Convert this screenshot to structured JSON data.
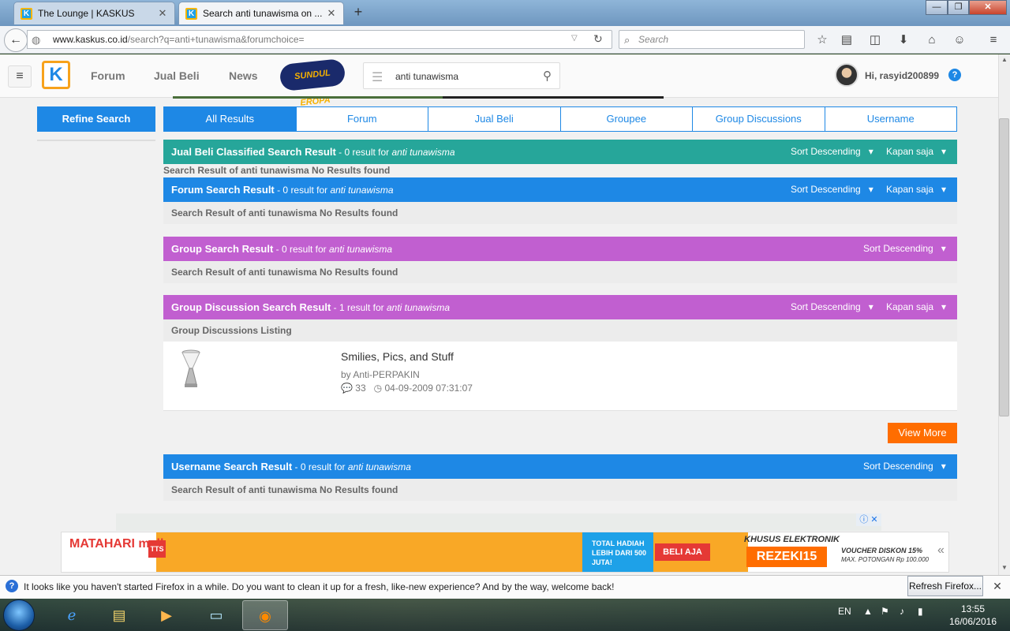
{
  "browser": {
    "tabs": [
      {
        "title": "The Lounge | KASKUS",
        "active": false
      },
      {
        "title": "Search anti tunawisma on ...",
        "active": true
      }
    ],
    "new_tab": "+",
    "url_domain": "www.kaskus.co.id",
    "url_path": "/search?q=anti+tunawisma&forumchoice=",
    "search_placeholder": "Search",
    "window_buttons": {
      "minimize": "—",
      "maximize": "❐",
      "close": "✕"
    }
  },
  "kaskus": {
    "nav": {
      "forum": "Forum",
      "jual_beli": "Jual Beli",
      "news": "News"
    },
    "logo": "K",
    "sundul_badge": "SUNDUL EROPA",
    "search_query": "anti tunawisma",
    "greeting": "Hi, rasyid200899",
    "help": "?",
    "refine_button": "Refine Search",
    "tabs": [
      "All Results",
      "Forum",
      "Jual Beli",
      "Groupee",
      "Group Discussions",
      "Username"
    ],
    "active_tab": "All Results",
    "sections": {
      "jualbeli": {
        "title": "Jual Beli Classified Search Result",
        "count": " - 0 result for ",
        "keyword": "anti tunawisma",
        "sort": "Sort Descending",
        "time": "Kapan saja",
        "message": "Search Result of anti tunawisma No Results found"
      },
      "forum": {
        "title": "Forum Search Result",
        "count": " - 0 result for ",
        "keyword": "anti tunawisma",
        "sort": "Sort Descending",
        "time": "Kapan saja",
        "message": "Search Result of anti tunawisma No Results found"
      },
      "group": {
        "title": "Group Search Result",
        "count": " - 0 result for ",
        "keyword": "anti tunawisma",
        "sort": "Sort Descending",
        "message": "Search Result of anti tunawisma No Results found"
      },
      "groupdisc": {
        "title": "Group Discussion Search Result",
        "count": " - 1 result for ",
        "keyword": "anti tunawisma",
        "sort": "Sort Descending",
        "time": "Kapan saja",
        "message": "Group Discussions Listing"
      },
      "username": {
        "title": "Username Search Result",
        "count": " - 0 result for ",
        "keyword": "anti tunawisma",
        "sort": "Sort Descending",
        "message": "Search Result of anti tunawisma No Results found"
      }
    },
    "result": {
      "title": "Smilies, Pics, and Stuff",
      "by": "by Anti-PERPAKIN",
      "comments": "33",
      "date": "04-09-2009 07:31:07"
    },
    "view_more": "View More",
    "ad": {
      "brand": "MATAHARI mall",
      "badge": "TTS",
      "promo": "TOTAL HADIAH LEBIH DARI 500 JUTA!",
      "cta": "BELI AJA",
      "heading": "KHUSUS ELEKTRONIK",
      "code": "REZEKI15",
      "voucher": "VOUCHER DISKON 15%",
      "cap": "MAX. POTONGAN Rp 100.000"
    }
  },
  "notification": {
    "text": "It looks like you haven't started Firefox in a while. Do you want to clean it up for a fresh, like-new experience? And by the way, welcome back!",
    "button": "Refresh Firefox..."
  },
  "taskbar": {
    "lang": "EN",
    "time": "13:55",
    "date": "16/06/2016"
  },
  "colors": {
    "kaskus_blue": "#1e88e5",
    "teal": "#26a69a",
    "purple": "#c15fd0",
    "orange": "#ff6d00"
  }
}
